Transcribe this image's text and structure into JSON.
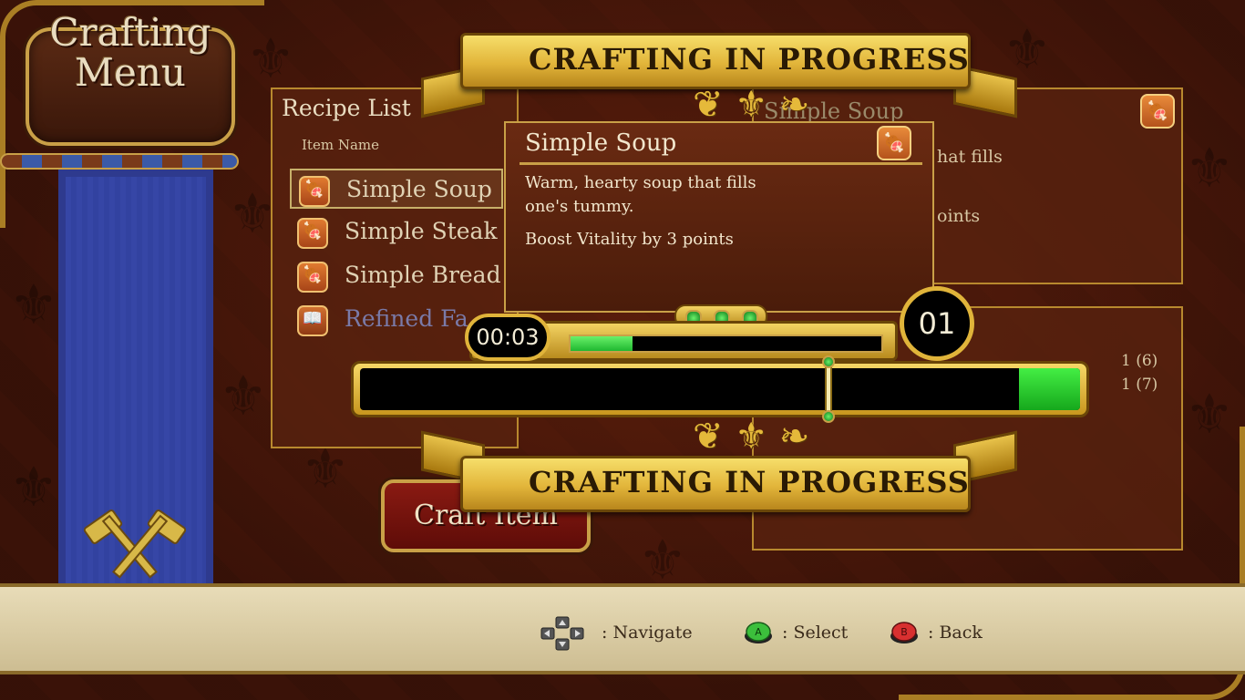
{
  "menu": {
    "title": "Crafting\nMenu"
  },
  "recipe_list": {
    "title": "Recipe List",
    "column_header": "Item Name",
    "items": [
      {
        "label": "Simple Soup",
        "icon": "meat-icon",
        "selected": true
      },
      {
        "label": "Simple Steak",
        "icon": "meat-icon",
        "selected": false
      },
      {
        "label": "Simple Bread",
        "icon": "meat-icon",
        "selected": false
      },
      {
        "label": "Refined Fa",
        "icon": "book-icon",
        "selected": false
      }
    ]
  },
  "right_panel": {
    "title_partial": "Simple Soup",
    "desc_partial": "hat fills",
    "effect_partial": "oints",
    "materials": [
      "1 (6)",
      "1 (7)"
    ]
  },
  "detail": {
    "title": "Simple Soup",
    "description": "Warm, hearty soup that fills one's tummy.",
    "effect": "Boost Vitality by 3 points"
  },
  "crafting": {
    "banner_top": "CRAFTING IN PROGRESS",
    "banner_bottom": "CRAFTING IN PROGRESS",
    "timer": "00:03",
    "count": "01",
    "time_progress": 0.2,
    "target_zone_start": 0.915,
    "target_zone_end": 1.0,
    "marker_position": 0.65
  },
  "craft_button": {
    "label": "Craft Item"
  },
  "hints": {
    "navigate": ": Navigate",
    "select": ": Select",
    "back": ": Back",
    "select_button": "A",
    "back_button": "B"
  },
  "colors": {
    "gold": "#e2b53a",
    "banner_blue": "#2e3a8e",
    "progress_green": "#1fb830",
    "craft_red": "#8a1a12"
  }
}
